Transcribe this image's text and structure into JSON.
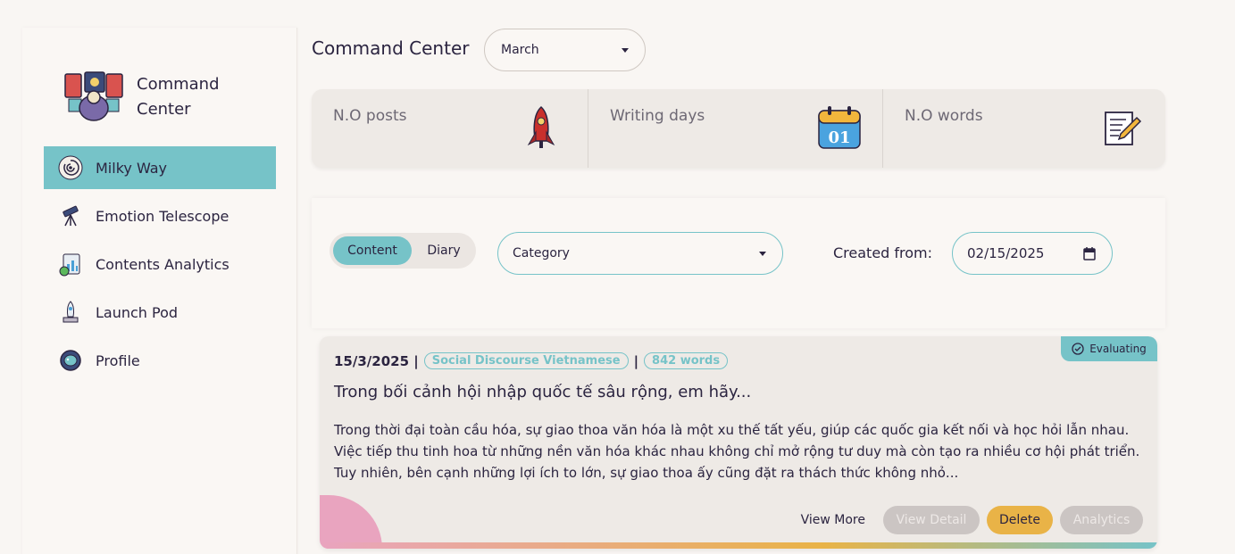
{
  "app": {
    "brand_name": "Command Center"
  },
  "sidebar": {
    "items": [
      {
        "label": "Milky Way",
        "icon": "galaxy-icon",
        "active": true
      },
      {
        "label": "Emotion Telescope",
        "icon": "telescope-icon",
        "active": false
      },
      {
        "label": "Contents Analytics",
        "icon": "analytics-icon",
        "active": false
      },
      {
        "label": "Launch Pod",
        "icon": "rocket-launch-icon",
        "active": false
      },
      {
        "label": "Profile",
        "icon": "astronaut-icon",
        "active": false
      }
    ]
  },
  "header": {
    "title": "Command Center",
    "month_value": "March"
  },
  "stats": [
    {
      "label": "N.O posts",
      "icon": "rocket-icon"
    },
    {
      "label": "Writing days",
      "icon": "calendar-icon",
      "icon_text": "01"
    },
    {
      "label": "N.O words",
      "icon": "notepad-pencil-icon"
    }
  ],
  "filters": {
    "toggle": {
      "content_label": "Content",
      "diary_label": "Diary",
      "selected": "Content"
    },
    "category_value": "Category",
    "created_from_label": "Created from:",
    "created_from_value": "02/15/2025"
  },
  "post": {
    "date": "15/3/2025 |",
    "category": "Social Discourse Vietnamese",
    "separator": "|",
    "word_count": "842 words",
    "status": "Evaluating",
    "title": "Trong bối cảnh hội nhập quốc tế sâu rộng, em hãy...",
    "excerpt": "Trong thời đại toàn cầu hóa, sự giao thoa văn hóa là một xu thế tất yếu, giúp các quốc gia kết nối và học hỏi lẫn nhau. Việc tiếp thu tinh hoa từ những nền văn hóa khác nhau không chỉ mở rộng tư duy mà còn tạo ra nhiều cơ hội phát triển. Tuy nhiên, bên cạnh những lợi ích to lớn, sự giao thoa ấy cũng đặt ra thách thức không nhỏ...",
    "actions": {
      "view_more": "View More",
      "view_detail": "View Detail",
      "delete": "Delete",
      "analytics": "Analytics"
    }
  },
  "colors": {
    "accent": "#76c3c8",
    "delete": "#e9b347",
    "disabled": "#cbc5c3",
    "pink": "#e9a4bf"
  }
}
